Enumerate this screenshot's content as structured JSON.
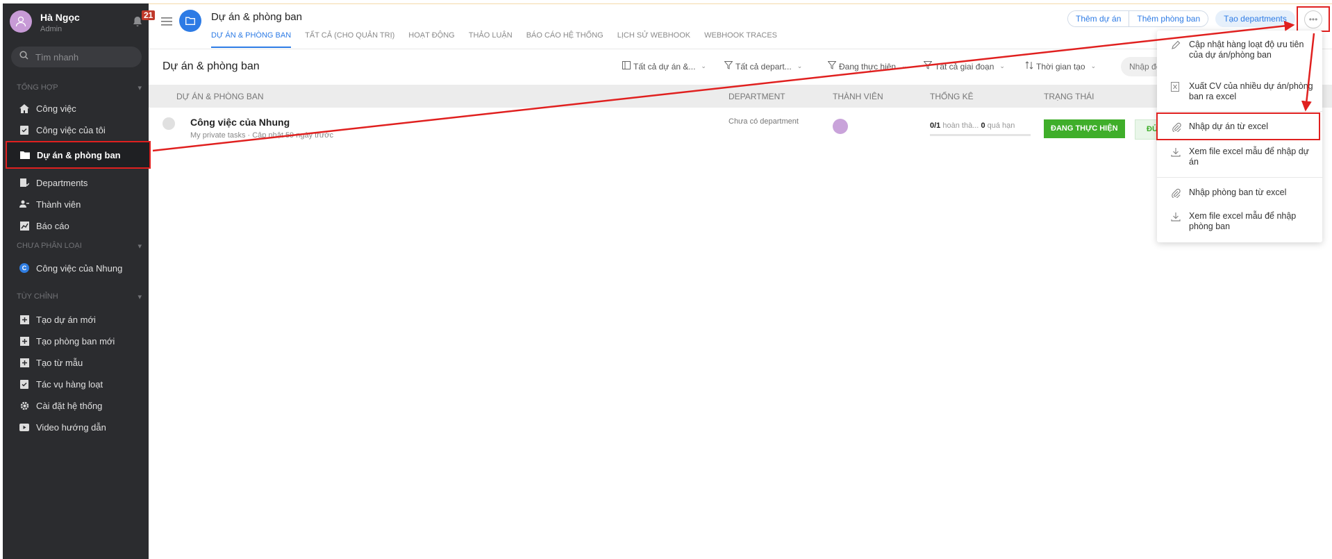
{
  "profile": {
    "name": "Hà Ngọc",
    "role": "Admin",
    "notifications": "21"
  },
  "sidebar": {
    "search_placeholder": "Tìm nhanh",
    "section_overview": "TỔNG HỢP",
    "section_uncategorized": "CHƯA PHÂN LOẠI",
    "section_custom": "TÙY CHỈNH",
    "overview_items": [
      "Công việc",
      "Công việc của tôi",
      "Dự án & phòng ban",
      "Departments",
      "Thành viên",
      "Báo cáo"
    ],
    "uncategorized_items": [
      {
        "badge": "C",
        "label": "Công việc của Nhung"
      }
    ],
    "custom_items": [
      "Tạo dự án mới",
      "Tạo phòng ban mới",
      "Tạo từ mẫu",
      "Tác vụ hàng loạt",
      "Cài đặt hệ thống",
      "Video hướng dẫn"
    ]
  },
  "header": {
    "title": "Dự án & phòng ban",
    "tabs": [
      "DỰ ÁN & PHÒNG BAN",
      "TẤT CẢ (CHO QUẢN TRỊ)",
      "HOẠT ĐỘNG",
      "THẢO LUẬN",
      "BÁO CÁO HỆ THỐNG",
      "LỊCH SỬ WEBHOOK",
      "WEBHOOK TRACES"
    ],
    "btn_add_project": "Thêm dự án",
    "btn_add_department": "Thêm phòng ban",
    "btn_create_departments": "Tạo departments"
  },
  "toolbar": {
    "heading": "Dự án & phòng ban",
    "filters": [
      "Tất cả dự án &...",
      "Tất cả depart...",
      "Đang thực hiện",
      "Tất cả giai đoạn",
      "Thời gian tạo"
    ],
    "search_placeholder": "Nhập để"
  },
  "table": {
    "columns": [
      "DỰ ÁN & PHÒNG BAN",
      "DEPARTMENT",
      "THÀNH VIÊN",
      "THỐNG KÊ",
      "TRẠNG THÁI"
    ],
    "rows": [
      {
        "title": "Công việc của Nhung",
        "subtitle": "My private tasks · Cập nhật 59 ngày trước",
        "department": "Chưa có department",
        "done": "0",
        "total": "/1",
        "done_label": "hoàn thà...",
        "overdue": "0",
        "overdue_label": "quá hạn",
        "status": "ĐANG THỰC HIỆN",
        "status2": "ĐỦ"
      }
    ]
  },
  "menu": {
    "items": [
      "Cập nhật hàng loạt độ ưu tiên của dự án/phòng ban",
      "Xuất CV của nhiều dự án/phòng ban ra excel",
      "Nhập dự án từ excel",
      "Xem file excel mẫu để nhập dự án",
      "Nhập phòng ban từ excel",
      "Xem file excel mẫu để nhập phòng ban"
    ]
  },
  "colors": {
    "accent": "#2d7be5",
    "sidebar_bg": "#2b2c2f",
    "status_green": "#3fae2a",
    "highlight_red": "#e0201f"
  }
}
